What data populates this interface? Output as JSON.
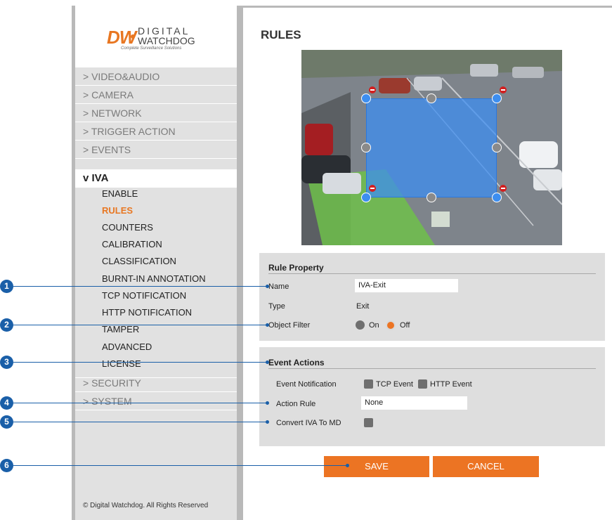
{
  "logo": {
    "brand_initials": "DW",
    "brand_line1": "DIGITAL",
    "brand_line2": "WATCHDOG",
    "tagline": "Complete Surveillance Solutions"
  },
  "sidebar": {
    "items": [
      {
        "label": "> VIDEO&AUDIO"
      },
      {
        "label": "> CAMERA"
      },
      {
        "label": "> NETWORK"
      },
      {
        "label": "> TRIGGER ACTION"
      },
      {
        "label": "> EVENTS"
      },
      {
        "label": "v IVA"
      }
    ],
    "iva_submenu": [
      "ENABLE",
      "RULES",
      "COUNTERS",
      "CALIBRATION",
      "CLASSIFICATION",
      "BURNT-IN ANNOTATION",
      "TCP NOTIFICATION",
      "HTTP NOTIFICATION",
      "TAMPER",
      "ADVANCED",
      "LICENSE"
    ],
    "active_sub": "RULES",
    "bottom_items": [
      {
        "label": "> SECURITY"
      },
      {
        "label": "> SYSTEM"
      }
    ],
    "copyright": "© Digital Watchdog. All Rights Reserved"
  },
  "main": {
    "title": "RULES",
    "rule_property": {
      "heading": "Rule Property",
      "name_label": "Name",
      "name_value": "IVA-Exit",
      "type_label": "Type",
      "type_value": "Exit",
      "object_filter_label": "Object Filter",
      "on_label": "On",
      "off_label": "Off",
      "selected": "Off"
    },
    "event_actions": {
      "heading": "Event Actions",
      "event_notification_label": "Event Notification",
      "tcp_event_label": "TCP Event",
      "http_event_label": "HTTP Event",
      "action_rule_label": "Action Rule",
      "action_rule_value": "None",
      "convert_label": "Convert IVA To MD"
    },
    "save_label": "SAVE",
    "cancel_label": "CANCEL"
  },
  "callouts": [
    "1",
    "2",
    "3",
    "4",
    "5",
    "6"
  ],
  "colors": {
    "accent": "#ec7423",
    "callout": "#1a5fa8",
    "zone": "#3d8ef0",
    "sidebar_bg": "#e1e1e1",
    "panel_bg": "#dedede"
  }
}
